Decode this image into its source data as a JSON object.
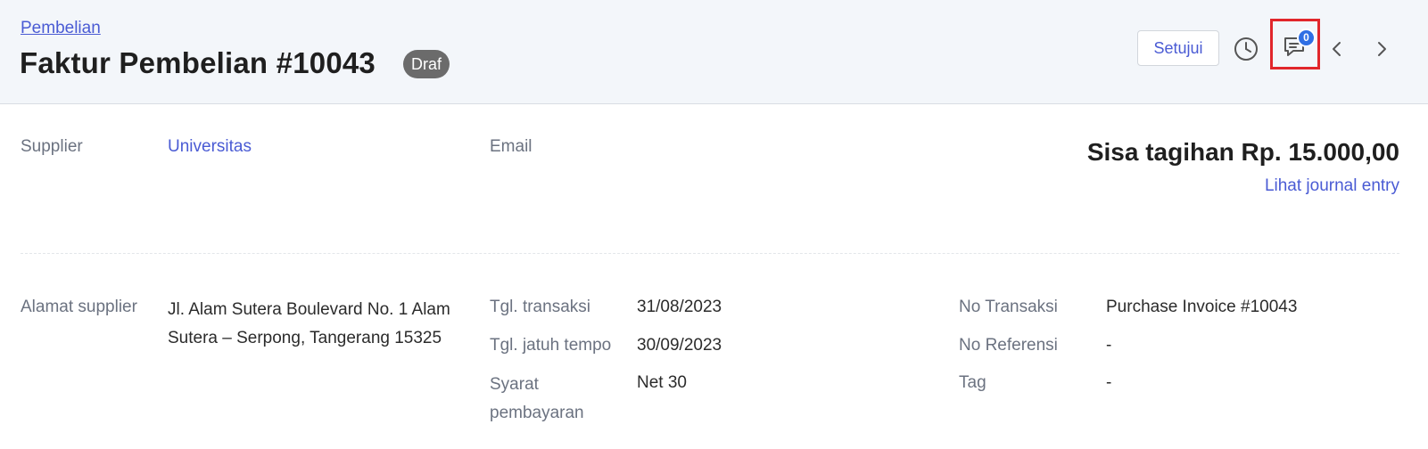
{
  "header": {
    "breadcrumb": "Pembelian",
    "title": "Faktur Pembelian #10043",
    "status": "Draf",
    "approve_label": "Setujui",
    "comment_count": "0",
    "icons": [
      "history-icon",
      "comment-icon",
      "chevron-left-icon",
      "chevron-right-icon"
    ]
  },
  "summary": {
    "supplier_label": "Supplier",
    "supplier_value": "Universitas",
    "email_label": "Email",
    "balance": "Sisa tagihan Rp. 15.000,00",
    "journal_link": "Lihat journal entry"
  },
  "details": {
    "address_label": "Alamat supplier",
    "address_value": "Jl. Alam Sutera Boulevard No. 1 Alam Sutera – Serpong, Tangerang 15325",
    "transaction_date_label": "Tgl. transaksi",
    "transaction_date_value": "31/08/2023",
    "due_date_label": "Tgl. jatuh tempo",
    "due_date_value": "30/09/2023",
    "payment_terms_label": "Syarat pembayaran",
    "payment_terms_value": "Net 30",
    "transaction_no_label": "No Transaksi",
    "transaction_no_value": "Purchase Invoice #10043",
    "reference_no_label": "No Referensi",
    "reference_no_value": "-",
    "tag_label": "Tag",
    "tag_value": "-"
  },
  "colors": {
    "accent": "#4a5bd4",
    "header_bg": "#f3f6fa",
    "badge_bg": "#6b6b6b",
    "highlight": "#e1262b",
    "notification": "#2f6fe4"
  }
}
